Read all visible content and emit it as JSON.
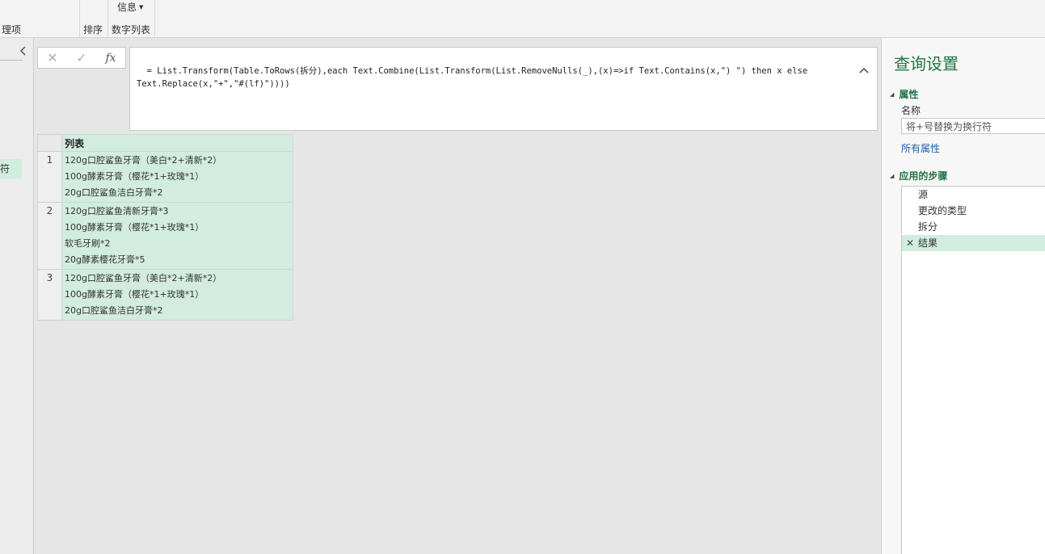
{
  "ribbon": {
    "group1_label": "理项",
    "group2_label": "排序",
    "group3_label": "数字列表",
    "info_label": "信息"
  },
  "leftnav": {
    "query_item": "符"
  },
  "formula_bar": {
    "fx_label": "fx",
    "formula": "= List.Transform(Table.ToRows(拆分),each Text.Combine(List.Transform(List.RemoveNulls(_),(x)=>if Text.Contains(x,\") \") then x else\nText.Replace(x,\"+\",\"#(lf)\"))))"
  },
  "table": {
    "column_header": "列表",
    "rows": [
      {
        "num": "1",
        "lines": [
          "120g口腔鲨鱼牙膏（美白*2+清新*2）",
          "100g酵素牙膏（樱花*1+玫瑰*1）",
          "20g口腔鲨鱼洁白牙膏*2"
        ]
      },
      {
        "num": "2",
        "lines": [
          "120g口腔鲨鱼清新牙膏*3",
          "100g酵素牙膏（樱花*1+玫瑰*1）",
          "软毛牙刷*2",
          "20g酵素樱花牙膏*5"
        ]
      },
      {
        "num": "3",
        "lines": [
          "120g口腔鲨鱼牙膏（美白*2+清新*2）",
          "100g酵素牙膏（樱花*1+玫瑰*1）",
          "20g口腔鲨鱼洁白牙膏*2"
        ]
      }
    ]
  },
  "query_settings": {
    "title": "查询设置",
    "properties_header": "属性",
    "name_label": "名称",
    "name_value": "将+号替换为换行符",
    "all_properties_link": "所有属性",
    "applied_steps_header": "应用的步骤",
    "steps": [
      "源",
      "更改的类型",
      "拆分",
      "结果"
    ]
  },
  "colors": {
    "accent": "#217346",
    "selection": "#d2ecdf"
  }
}
